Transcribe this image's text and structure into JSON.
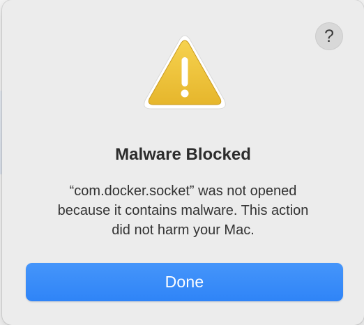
{
  "dialog": {
    "help_label": "?",
    "icon": "warning-triangle-icon",
    "title": "Malware Blocked",
    "message_lines": [
      "“com.docker.socket” was not opened",
      "because it contains malware. This action",
      "did not harm your Mac."
    ],
    "done_label": "Done"
  },
  "colors": {
    "dialog_background": "#ececec",
    "accent_button": "#3a8cf8",
    "warning_yellow": "#f0c43a",
    "warning_mark": "#ffffff"
  }
}
